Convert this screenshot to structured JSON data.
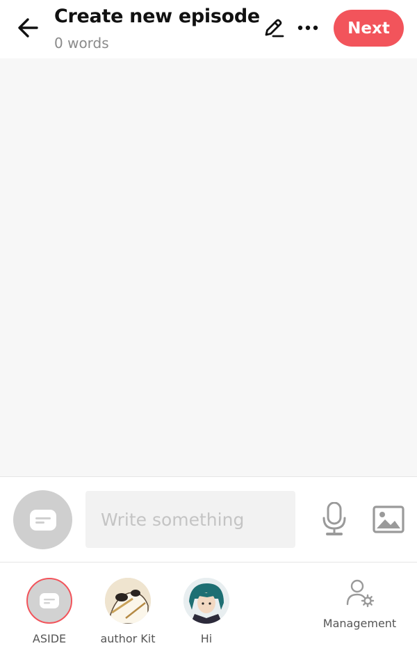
{
  "header": {
    "title": "Create new episode",
    "word_count": "0 words",
    "next_label": "Next",
    "back_icon": "arrow-left-icon",
    "edit_icon": "pencil-icon",
    "more_icon": "more-horizontal-icon"
  },
  "composer": {
    "placeholder": "Write something",
    "value": "",
    "aside_icon": "chat-bubble-icon",
    "mic_icon": "microphone-icon",
    "image_icon": "image-icon"
  },
  "characters": [
    {
      "label": "ASIDE",
      "selected": true
    },
    {
      "label": "author Kit",
      "selected": false
    },
    {
      "label": "Hi",
      "selected": false
    }
  ],
  "management": {
    "label": "Management",
    "icon": "user-settings-icon"
  },
  "colors": {
    "accent": "#f2545b",
    "content_bg": "#f7f7f7",
    "muted_text": "#8a8a8a",
    "aside_gray": "#cfcfcf"
  }
}
